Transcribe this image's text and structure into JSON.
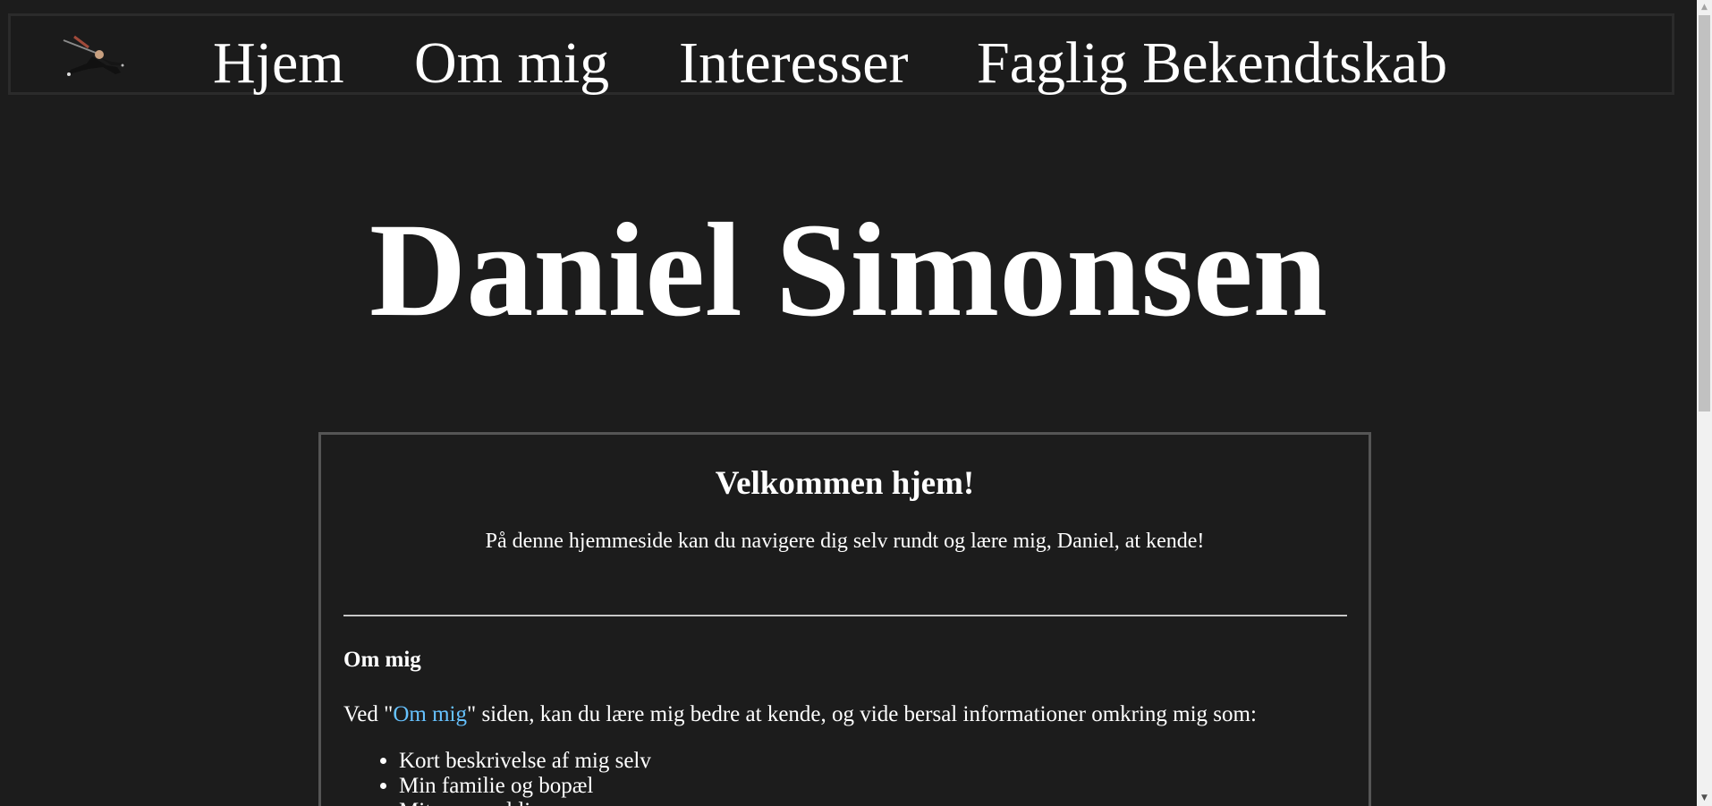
{
  "nav": {
    "logo_icon": "dancer-silhouette-icon",
    "items": [
      {
        "label": "Hjem"
      },
      {
        "label": "Om mig"
      },
      {
        "label": "Interesser"
      },
      {
        "label": "Faglig Bekendtskab"
      }
    ]
  },
  "header": {
    "title": "Daniel Simonsen"
  },
  "welcome": {
    "heading": "Velkommen hjem!",
    "text": "På denne hjemmeside kan du navigere dig selv rundt og lære mig, Daniel, at kende!"
  },
  "om_mig_section": {
    "heading": "Om mig",
    "text_before": "Ved \"",
    "link_label": "Om mig",
    "text_after": "\" siden, kan du lære mig bedre at kende, og vide bersal informationer omkring mig som:",
    "list": [
      "Kort beskrivelse af mig selv",
      "Min familie og bopæl",
      "Mit personal liv"
    ]
  },
  "colors": {
    "background": "#1c1c1c",
    "text": "#ffffff",
    "link": "#66c2ff",
    "box_border": "#555555"
  }
}
